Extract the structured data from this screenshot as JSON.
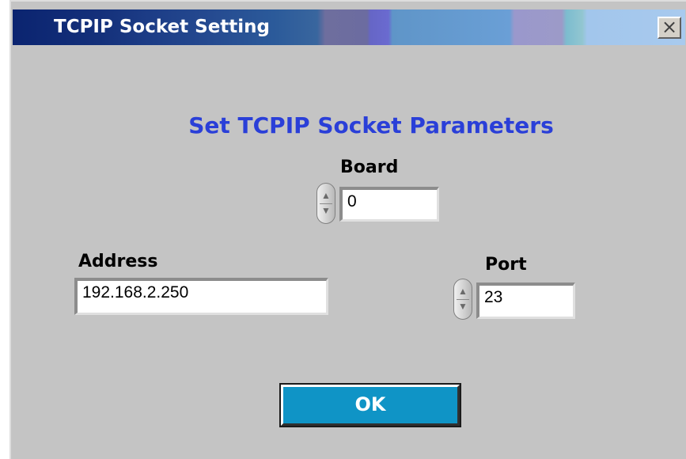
{
  "window": {
    "title": "TCPIP Socket Setting",
    "close_symbol": "×"
  },
  "heading": "Set TCPIP Socket Parameters",
  "board": {
    "label": "Board",
    "value": "0"
  },
  "address": {
    "label": "Address",
    "value": "192.168.2.250"
  },
  "port": {
    "label": "Port",
    "value": "23"
  },
  "buttons": {
    "ok": "OK"
  },
  "icons": {
    "spinner_up": "▲",
    "spinner_down": "▼"
  },
  "colors": {
    "heading": "#2a3fd8",
    "ok_button": "#0f94c6",
    "title_bar_start": "#0b2470"
  }
}
